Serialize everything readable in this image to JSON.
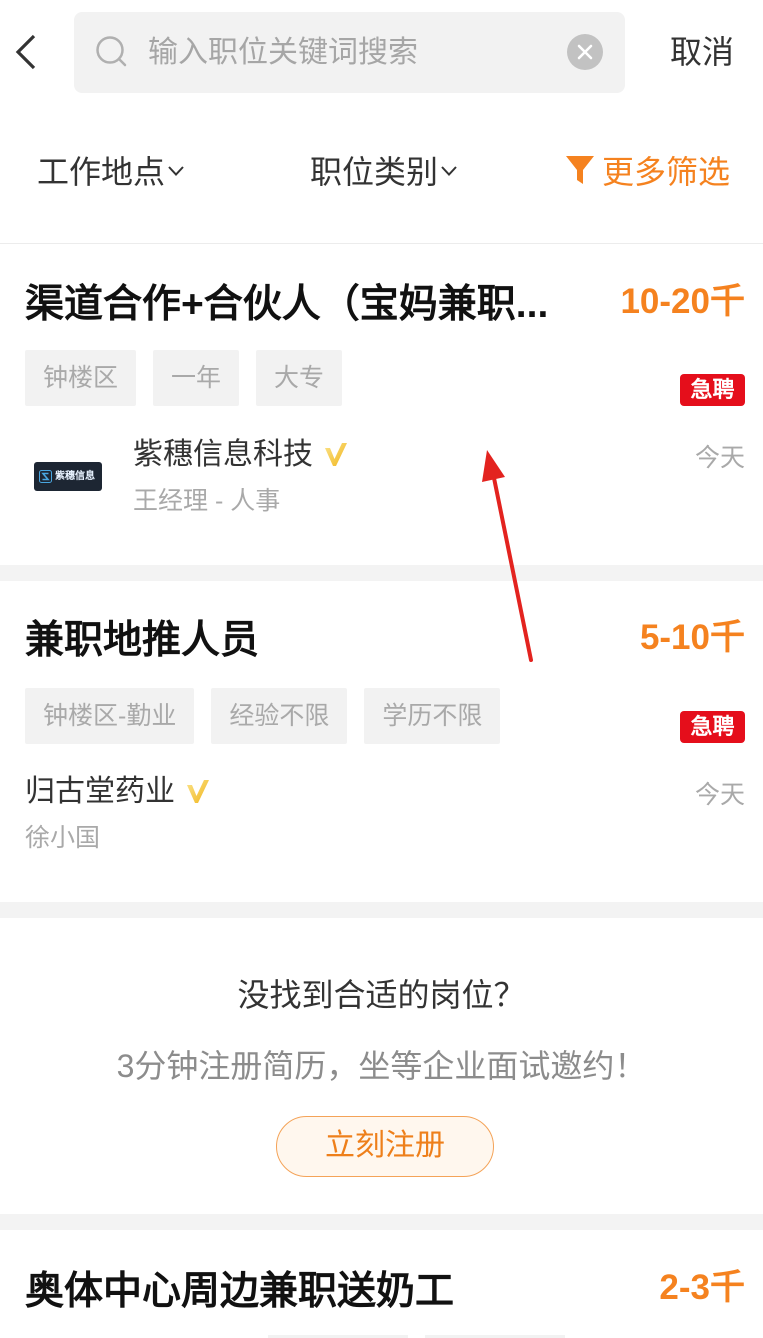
{
  "header": {
    "back_icon": "chevron-left-icon",
    "search": {
      "icon": "search-icon",
      "placeholder": "输入职位关键词搜索",
      "value": "",
      "clear_icon": "clear-icon"
    },
    "cancel_label": "取消"
  },
  "filters": {
    "location": {
      "label": "工作地点",
      "icon": "chevron-down-icon"
    },
    "category": {
      "label": "职位类别",
      "icon": "chevron-down-icon"
    },
    "more": {
      "label": "更多筛选",
      "icon": "funnel-icon"
    }
  },
  "jobs": [
    {
      "title": "渠道合作+合伙人（宝妈兼职...",
      "salary": "10-20千",
      "tags": [
        "钟楼区",
        "一年",
        "大专"
      ],
      "urgent_label": "急聘",
      "company": {
        "logo_text": "紫穗信息",
        "name": "紫穗信息科技",
        "verified": true,
        "verified_icon": "verified-badge-icon"
      },
      "contact": "王经理 - 人事",
      "date": "今天"
    },
    {
      "title": "兼职地推人员",
      "salary": "5-10千",
      "tags": [
        "钟楼区-勤业",
        "经验不限",
        "学历不限"
      ],
      "urgent_label": "急聘",
      "company": {
        "name": "归古堂药业",
        "verified": true,
        "verified_icon": "verified-badge-icon"
      },
      "contact": "徐小国",
      "date": "今天"
    },
    {
      "title": "奥体中心周边兼职送奶工",
      "salary": "2-3千"
    }
  ],
  "register_promo": {
    "question": "没找到合适的岗位？",
    "subtext": "3分钟注册简历，坐等企业面试邀约！",
    "button_label": "立刻注册"
  },
  "colors": {
    "accent_orange": "#f5821f",
    "urgent_red": "#e50e1b",
    "verified_gold": "#f2c230",
    "register_button_border": "#f4a358",
    "register_button_bg": "#fff7ee",
    "annotation_arrow": "#e3231f"
  }
}
